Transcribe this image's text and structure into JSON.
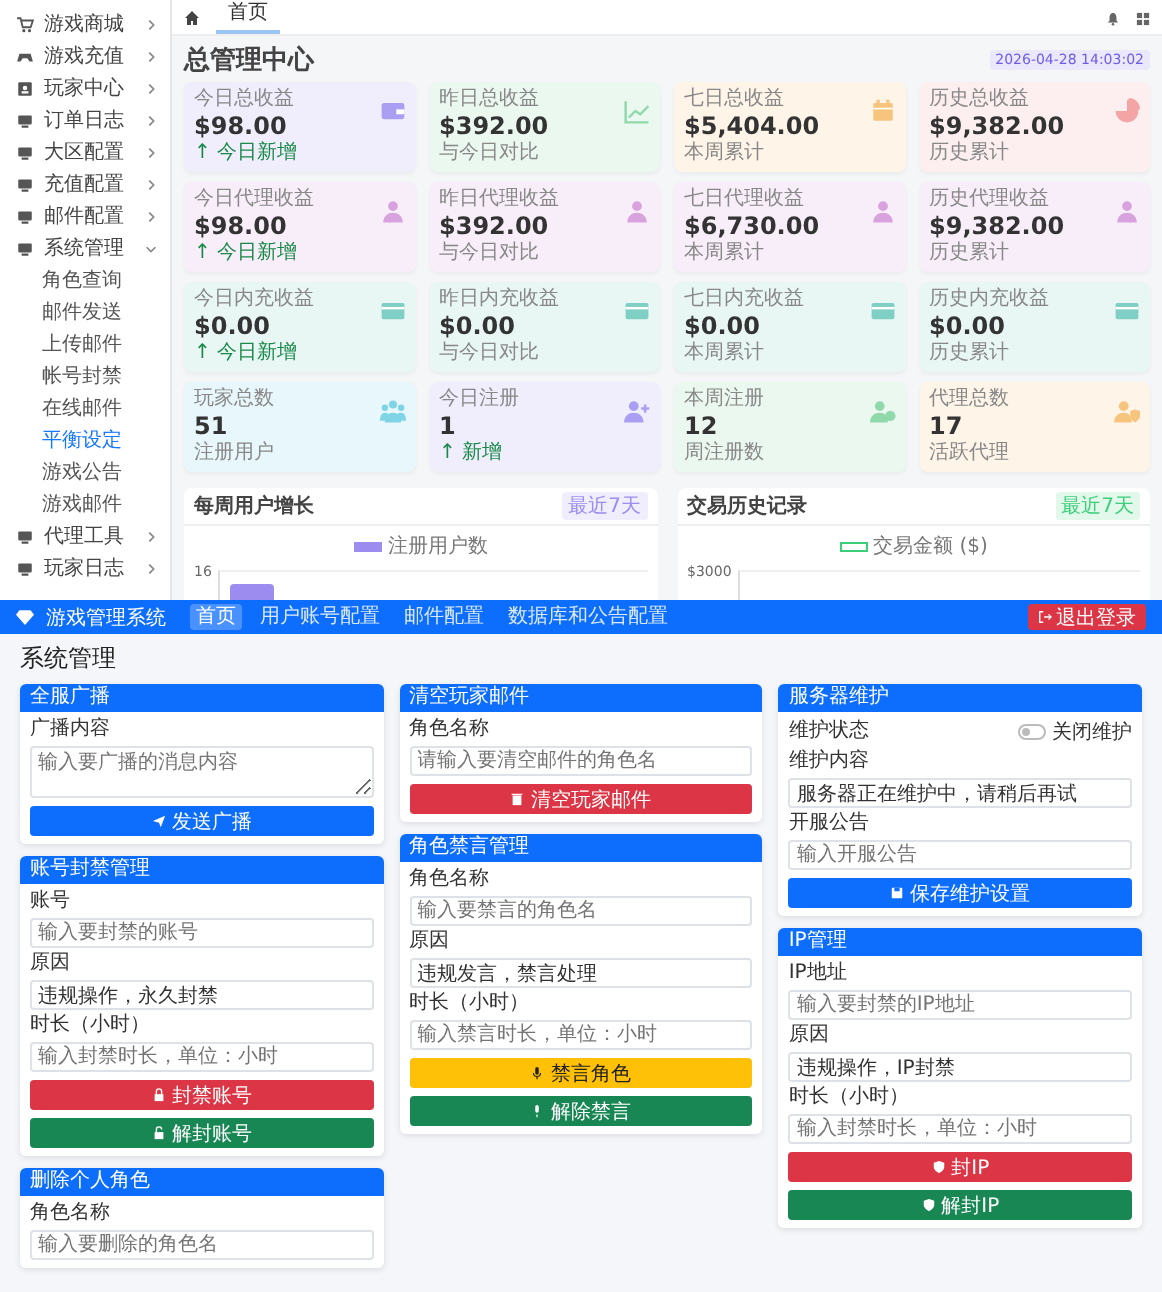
{
  "sidebar": {
    "items": [
      {
        "label": "游戏商城",
        "expanded": false
      },
      {
        "label": "游戏充值",
        "expanded": false
      },
      {
        "label": "玩家中心",
        "expanded": false
      },
      {
        "label": "订单日志",
        "expanded": false
      },
      {
        "label": "大区配置",
        "expanded": false
      },
      {
        "label": "充值配置",
        "expanded": false
      },
      {
        "label": "邮件配置",
        "expanded": false
      },
      {
        "label": "系统管理",
        "expanded": true,
        "children": [
          {
            "label": "角色查询",
            "selected": false
          },
          {
            "label": "邮件发送",
            "selected": false
          },
          {
            "label": "上传邮件",
            "selected": false
          },
          {
            "label": "帐号封禁",
            "selected": false
          },
          {
            "label": "在线邮件",
            "selected": false
          },
          {
            "label": "平衡设定",
            "selected": true
          },
          {
            "label": "游戏公告",
            "selected": false
          },
          {
            "label": "游戏邮件",
            "selected": false
          }
        ]
      },
      {
        "label": "代理工具",
        "expanded": false
      },
      {
        "label": "玩家日志",
        "expanded": false
      }
    ]
  },
  "dashboard": {
    "tabs": [
      {
        "label": "首页",
        "selected": true
      }
    ],
    "title": "总管理中心",
    "date": "2026-04-28 14:03:02",
    "cards": [
      {
        "label": "今日总收益",
        "value": "$98.00",
        "note": "↑ 今日新增",
        "positive": true,
        "color": "#a99ef2"
      },
      {
        "label": "昨日总收益",
        "value": "$392.00",
        "note": "与今日对比",
        "positive": false,
        "color": "#8fd9aa"
      },
      {
        "label": "七日总收益",
        "value": "$5,404.00",
        "note": "本周累计",
        "positive": false,
        "color": "#f7c47e"
      },
      {
        "label": "历史总收益",
        "value": "$9,382.00",
        "note": "历史累计",
        "positive": false,
        "color": "#f3a5a5"
      },
      {
        "label": "今日代理收益",
        "value": "$98.00",
        "note": "↑ 今日新增",
        "positive": true,
        "color": "#d8a2de"
      },
      {
        "label": "昨日代理收益",
        "value": "$392.00",
        "note": "与今日对比",
        "positive": false,
        "color": "#d8a2de"
      },
      {
        "label": "七日代理收益",
        "value": "$6,730.00",
        "note": "本周累计",
        "positive": false,
        "color": "#d8a2de"
      },
      {
        "label": "历史代理收益",
        "value": "$9,382.00",
        "note": "历史累计",
        "positive": false,
        "color": "#d8a2de"
      },
      {
        "label": "今日内充收益",
        "value": "$0.00",
        "note": "↑ 今日新增",
        "positive": true,
        "color": "#7fcfc4"
      },
      {
        "label": "昨日内充收益",
        "value": "$0.00",
        "note": "与今日对比",
        "positive": false,
        "color": "#7fcfc4"
      },
      {
        "label": "七日内充收益",
        "value": "$0.00",
        "note": "本周累计",
        "positive": false,
        "color": "#7fcfc4"
      },
      {
        "label": "历史内充收益",
        "value": "$0.00",
        "note": "历史累计",
        "positive": false,
        "color": "#7fcfc4"
      },
      {
        "label": "玩家总数",
        "value": "51",
        "note": "注册用户",
        "positive": false,
        "color": "#7fd4e6"
      },
      {
        "label": "今日注册",
        "value": "1",
        "note": "↑ 新增",
        "positive": true,
        "color": "#a99ef2"
      },
      {
        "label": "本周注册",
        "value": "12",
        "note": "周注册数",
        "positive": false,
        "color": "#8fd9aa"
      },
      {
        "label": "代理总数",
        "value": "17",
        "note": "活跃代理",
        "positive": false,
        "color": "#f7c47e"
      }
    ],
    "charts": [
      {
        "title": "每周用户增长",
        "badge": "最近7天",
        "legend": "注册用户数",
        "tick": "16",
        "kind": "bar",
        "color": "#9c8cf0"
      },
      {
        "title": "交易历史记录",
        "badge": "最近7天",
        "legend": "交易金额 ($)",
        "tick": "$3000",
        "kind": "line",
        "color": "#3ccf7a"
      }
    ]
  },
  "admin": {
    "brand": "游戏管理系统",
    "nav": [
      {
        "label": "首页",
        "selected": true
      },
      {
        "label": "用户账号配置",
        "selected": false
      },
      {
        "label": "邮件配置",
        "selected": false
      },
      {
        "label": "数据库和公告配置",
        "selected": false
      }
    ],
    "logout": "退出登录",
    "title": "系统管理",
    "cards": [
      {
        "title": "全服广播",
        "fields": [
          {
            "kind": "textarea",
            "label": "广播内容",
            "placeholder": "输入要广播的消息内容"
          }
        ],
        "buttons": [
          {
            "label": "发送广播",
            "kind": "primary"
          }
        ]
      },
      {
        "title": "清空玩家邮件",
        "fields": [
          {
            "kind": "input",
            "label": "角色名称",
            "placeholder": "请输入要清空邮件的角色名"
          }
        ],
        "buttons": [
          {
            "label": "清空玩家邮件",
            "kind": "danger"
          }
        ]
      },
      {
        "title": "服务器维护",
        "fields": [
          {
            "kind": "switch",
            "label": "维护状态",
            "text": "关闭维护",
            "on": false
          },
          {
            "kind": "input",
            "label": "维护内容",
            "value": "服务器正在维护中，请稍后再试"
          },
          {
            "kind": "input",
            "label": "开服公告",
            "placeholder": "输入开服公告"
          }
        ],
        "buttons": [
          {
            "label": "保存维护设置",
            "kind": "primary"
          }
        ]
      },
      {
        "title": "账号封禁管理",
        "fields": [
          {
            "kind": "input",
            "label": "账号",
            "placeholder": "输入要封禁的账号"
          },
          {
            "kind": "input",
            "label": "原因",
            "value": "违规操作，永久封禁"
          },
          {
            "kind": "input",
            "label": "时长（小时）",
            "placeholder": "输入封禁时长，单位：小时"
          }
        ],
        "buttons": [
          {
            "label": "封禁账号",
            "kind": "danger"
          },
          {
            "label": "解封账号",
            "kind": "success"
          }
        ]
      },
      {
        "title": "角色禁言管理",
        "fields": [
          {
            "kind": "input",
            "label": "角色名称",
            "placeholder": "输入要禁言的角色名"
          },
          {
            "kind": "input",
            "label": "原因",
            "value": "违规发言，禁言处理"
          },
          {
            "kind": "input",
            "label": "时长（小时）",
            "placeholder": "输入禁言时长，单位：小时"
          }
        ],
        "buttons": [
          {
            "label": "禁言角色",
            "kind": "warning"
          },
          {
            "label": "解除禁言",
            "kind": "success"
          }
        ]
      },
      {
        "title": "IP管理",
        "fields": [
          {
            "kind": "input",
            "label": "IP地址",
            "placeholder": "输入要封禁的IP地址"
          },
          {
            "kind": "input",
            "label": "原因",
            "value": "违规操作，IP封禁"
          },
          {
            "kind": "input",
            "label": "时长（小时）",
            "placeholder": "输入封禁时长，单位：小时"
          }
        ],
        "buttons": [
          {
            "label": "封IP",
            "kind": "danger"
          },
          {
            "label": "解封IP",
            "kind": "success"
          }
        ]
      },
      {
        "title": "删除个人角色",
        "fields": [
          {
            "kind": "input",
            "label": "角色名称",
            "placeholder": "输入要删除的角色名"
          }
        ]
      }
    ]
  }
}
